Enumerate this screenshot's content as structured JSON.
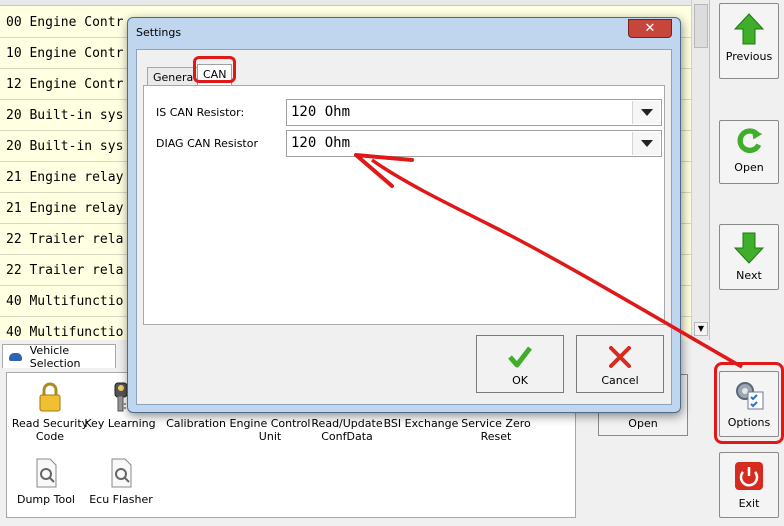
{
  "list": {
    "rows": [
      "00 Engine Contr",
      "10 Engine Contr",
      "12 Engine Contr",
      "20 Built-in sys",
      "20 Built-in sys",
      "21 Engine relay",
      "21 Engine relay",
      "22 Trailer rela",
      "22 Trailer rela",
      "40 Multifunctio",
      "40 Multifunctio"
    ]
  },
  "vehicle_tab": {
    "label": "Vehicle Selection"
  },
  "tools": [
    {
      "label": "Read Security Code",
      "icon": "padlock-icon"
    },
    {
      "label": "Key Learning",
      "icon": "key-icon"
    },
    {
      "label": "Calibration",
      "icon": "calibration-icon"
    },
    {
      "label": "Engine Control Unit",
      "icon": "ecu-icon"
    },
    {
      "label": "Read/Update ConfData",
      "icon": "confdata-icon"
    },
    {
      "label": "BSI Exchange",
      "icon": "bsi-icon"
    },
    {
      "label": "Service Zero Reset",
      "icon": "service-icon"
    },
    {
      "label": "Dump Tool",
      "icon": "dump-tool-icon"
    },
    {
      "label": "Ecu Flasher",
      "icon": "ecu-flasher-icon"
    }
  ],
  "side_buttons": {
    "previous": "Previous",
    "open": "Open",
    "next": "Next",
    "options": "Options",
    "exit": "Exit"
  },
  "open_button_2": "Open",
  "dialog": {
    "title": "Settings",
    "close_glyph": "✕",
    "tabs": {
      "general": "General",
      "can": "CAN"
    },
    "fields": {
      "is_can_label": "IS CAN Resistor:",
      "is_can_value": "120 Ohm",
      "diag_can_label": "DIAG CAN Resistor",
      "diag_can_value": "120 Ohm"
    },
    "ok": "OK",
    "cancel": "Cancel"
  },
  "colors": {
    "annotation_red": "#e01818",
    "green_arrow": "#3fae2a",
    "cancel_red": "#d62b1f",
    "list_bg": "#ffffe1"
  }
}
